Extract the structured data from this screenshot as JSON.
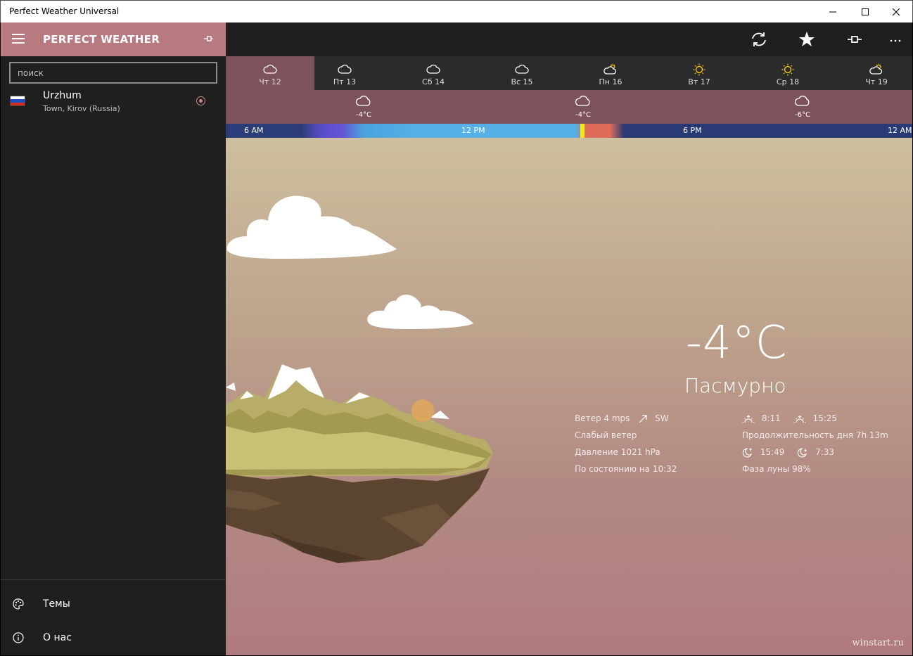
{
  "window": {
    "title": "Perfect Weather Universal"
  },
  "sidebar": {
    "app_title": "PERFECT WEATHER",
    "search_placeholder": "поиск",
    "location": {
      "name": "Urzhum",
      "sub": "Town, Kirov (Russia)"
    },
    "menu": [
      {
        "label": "Темы",
        "icon": "palette-icon"
      },
      {
        "label": "О нас",
        "icon": "info-icon"
      }
    ]
  },
  "toolbar": {
    "icons": [
      "refresh-icon",
      "star-icon",
      "pin-icon",
      "more-icon"
    ]
  },
  "days": [
    {
      "label": "Чт 12",
      "icon": "cloud",
      "selected": true
    },
    {
      "label": "Пт 13",
      "icon": "cloud"
    },
    {
      "label": "Сб 14",
      "icon": "cloud"
    },
    {
      "label": "Вс 15",
      "icon": "cloud"
    },
    {
      "label": "Пн 16",
      "icon": "partly-sunny"
    },
    {
      "label": "Вт 17",
      "icon": "sun"
    },
    {
      "label": "Ср 18",
      "icon": "sun"
    },
    {
      "label": "Чт 19",
      "icon": "partly-sunny"
    }
  ],
  "hourly": [
    {
      "temp": "-4°C"
    },
    {
      "temp": "-4°C"
    },
    {
      "temp": "-6°C"
    }
  ],
  "timeline": {
    "labels": [
      "6 AM",
      "12 PM",
      "6 PM",
      "12 AM"
    ]
  },
  "current": {
    "temp": "-4°C",
    "condition": "Пасмурно",
    "wind": "Ветер 4 mps",
    "wind_dir": "SW",
    "wind_desc": "Слабый ветер",
    "pressure": "Давление 1021 hPa",
    "updated": "По состоянию на 10:32",
    "sunrise": "8:11",
    "sunset": "15:25",
    "day_length": "Продолжительность дня 7h 13m",
    "moonrise": "15:49",
    "moonset": "7:33",
    "moon_phase": "Фаза луны 98%"
  },
  "watermark": "winstart.ru",
  "colors": {
    "accent": "#b77a80",
    "selected_day": "#7e525a",
    "sidebar_bg": "#1f1f1f"
  }
}
